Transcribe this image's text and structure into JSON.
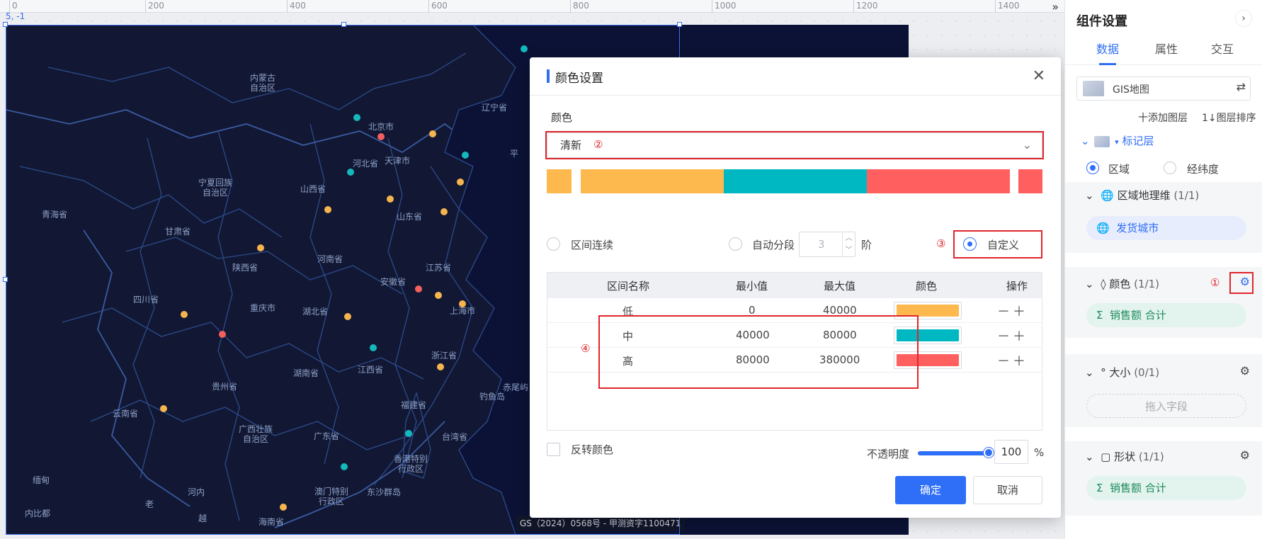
{
  "canvas": {
    "coord_readout": "5, -1",
    "ruler_ticks": [
      "0",
      "200",
      "400",
      "600",
      "800",
      "1000",
      "1200",
      "1400"
    ],
    "ruler_more_icon": "double-chevron-right-icon",
    "map": {
      "footer": "GS（2024）0568号 - 甲测资字1100471",
      "places": {
        "neimenggu": "内蒙古\n自治区",
        "liaoning": "辽宁省",
        "beijing": "北京市",
        "tianjin": "天津市",
        "hebei": "河北省",
        "ningxia": "宁夏回族\n自治区",
        "shanxi": "山西省",
        "qinghai": "青海省",
        "gansu": "甘肃省",
        "shandong": "山东省",
        "shaanxi": "陕西省",
        "henan": "河南省",
        "jiangsu": "江苏省",
        "anhui": "安徽省",
        "sichuan": "四川省",
        "chongqing": "重庆市",
        "hubei": "湖北省",
        "shanghai": "上海市",
        "zhejiang": "浙江省",
        "jiangxi": "江西省",
        "hunan": "湖南省",
        "guizhou": "贵州省",
        "chiwei": "赤尾屿",
        "diaoyu": "钓鱼岛",
        "fujian": "福建省",
        "yunnan": "云南省",
        "guangxi": "广西壮族\n自治区",
        "guangdong": "广东省",
        "taiwan": "台湾省",
        "hongkong": "香港特别\n行政区",
        "macau": "澳门特别\n行政区",
        "dongsha": "东沙群岛",
        "myanmar": "缅甸",
        "laos": "老",
        "vietnam": "越",
        "hainan": "海南省",
        "hanoi": "河内",
        "naypyidaw": "内比都",
        "ping": "平"
      }
    }
  },
  "modal": {
    "title": "颜色设置",
    "close_icon": "close-icon",
    "color_label": "颜色",
    "scheme_value": "清新",
    "annotation_numbers": [
      "①",
      "②",
      "③",
      "④"
    ],
    "swatches": [
      "#fdb94e",
      "#fdb94e",
      "#00b8c2",
      "#ff5f5f",
      "#ff5f5f"
    ],
    "mode_options": {
      "continuous": "区间连续",
      "auto": "自动分段",
      "auto_value": "3",
      "auto_unit": "阶",
      "custom": "自定义",
      "selected": "custom"
    },
    "table": {
      "headers": [
        "区间名称",
        "最小值",
        "最大值",
        "颜色",
        "操作"
      ],
      "rows": [
        {
          "name": "低",
          "min": "0",
          "max": "40000",
          "color": "#fdb94e",
          "ops": "－＋"
        },
        {
          "name": "中",
          "min": "40000",
          "max": "80000",
          "color": "#00b8c2",
          "ops": "－＋"
        },
        {
          "name": "高",
          "min": "80000",
          "max": "380000",
          "color": "#ff5f5f",
          "ops": "－＋"
        }
      ]
    },
    "reverse_label": "反转颜色",
    "opacity_label": "不透明度",
    "opacity_value": "100",
    "opacity_unit": "%",
    "opacity_level": 1.0,
    "ok_label": "确定",
    "cancel_label": "取消"
  },
  "panel": {
    "title": "组件设置",
    "tabs": [
      "数据",
      "属性",
      "交互"
    ],
    "active_tab": "数据",
    "layer_name": "GIS地图",
    "add_layer": "十添加图层",
    "sort_layer": "1↓图层排序",
    "marker_layer": "标记层",
    "location_options": [
      "区域",
      "经纬度"
    ],
    "region_dim": {
      "title": "区域地理维",
      "count": "(1/1)",
      "field": "发货城市"
    },
    "color": {
      "title": "颜色",
      "count": "(1/1)",
      "field": "销售额 合计"
    },
    "size": {
      "title": "大小",
      "count": "(0/1)",
      "placeholder": "拖入字段"
    },
    "shape": {
      "title": "形状",
      "count": "(1/1)",
      "field": "销售额 合计"
    }
  }
}
